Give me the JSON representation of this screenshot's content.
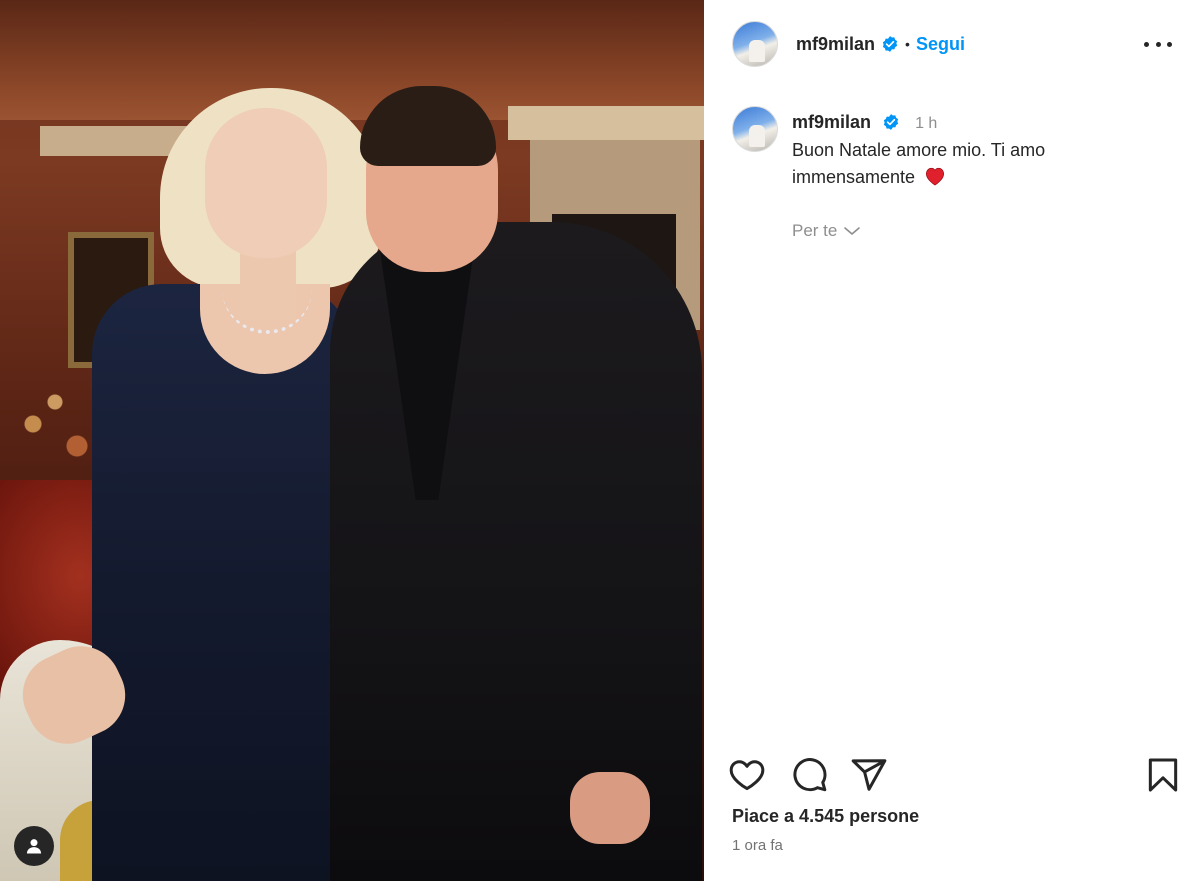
{
  "post": {
    "author": {
      "username": "mf9milan",
      "verified": true,
      "follow_label": "Segui",
      "separator": "•"
    },
    "caption": {
      "username": "mf9milan",
      "time": "1 h",
      "text": "Buon Natale amore mio. Ti amo immensamente",
      "emoji": "red-heart"
    },
    "translation_toggle": "Per te",
    "likes_text": "Piace a 4.545 persone",
    "posted_ago": "1 ora fa"
  },
  "icons": {
    "more": "more-options-icon",
    "like": "heart-icon",
    "comment": "comment-icon",
    "share": "paper-plane-icon",
    "save": "bookmark-icon",
    "tagged_users": "user-tag-icon"
  },
  "colors": {
    "accent": "#0095f6",
    "text": "#262626",
    "muted": "#8e8e8e",
    "verified": "#0095f6",
    "heart": "#e0202c"
  }
}
